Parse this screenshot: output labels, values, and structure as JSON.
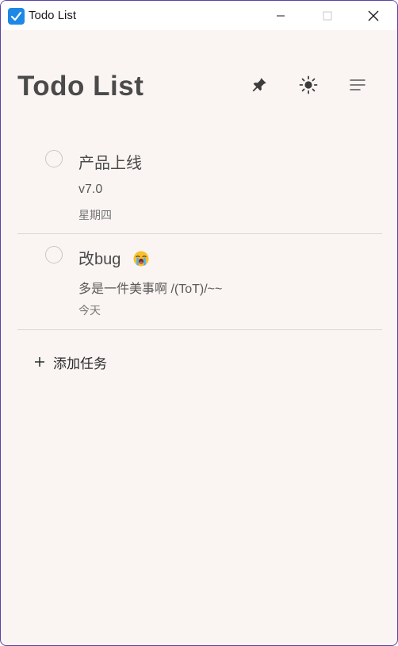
{
  "window": {
    "title": "Todo List"
  },
  "header": {
    "title": "Todo List",
    "buttons": {
      "pin": "pin-icon",
      "theme": "sun-icon",
      "sort": "menu-lines-icon"
    }
  },
  "tasks": [
    {
      "title": "产品上线",
      "note": "v7.0",
      "date": "星期四",
      "completed": false
    },
    {
      "title": "改bug",
      "emoji": "crying-face-icon",
      "note": "多是一件美事啊 /(ToT)/~~",
      "date": "今天",
      "completed": false
    }
  ],
  "add_task": {
    "label": "添加任务"
  },
  "colors": {
    "background": "#faf5f2",
    "titlebar": "#ffffff",
    "accent": "#1e88e5",
    "text": "#4a4a4a",
    "divider": "#dcd6d2"
  }
}
